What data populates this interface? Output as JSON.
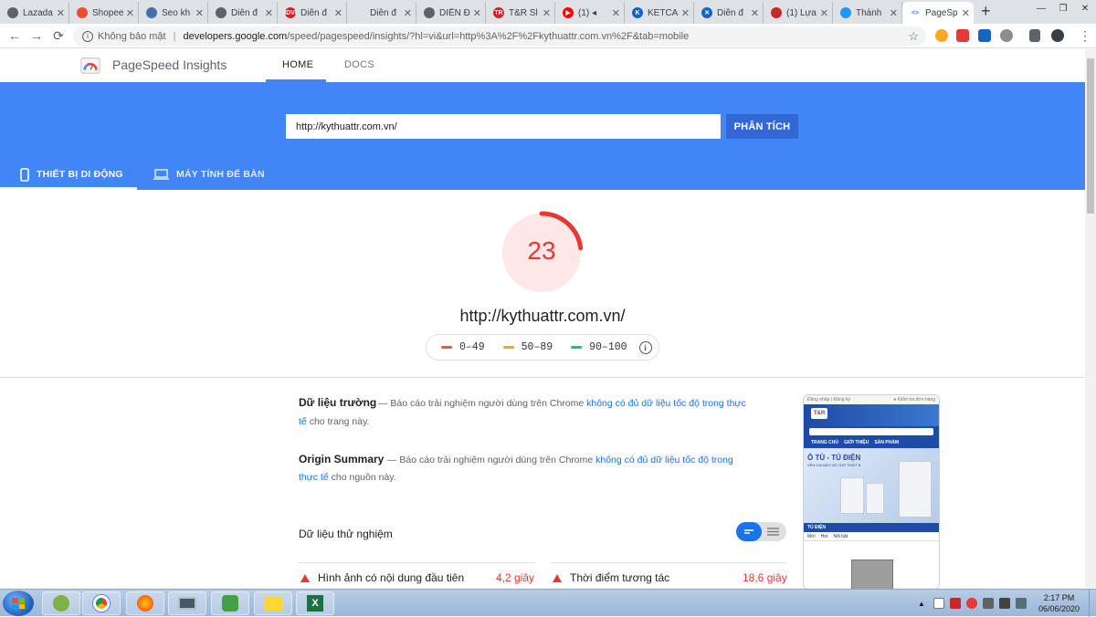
{
  "browser": {
    "tabs": [
      {
        "title": "Lazada",
        "favicon_color": "#5f6368",
        "favicon_glyph": ""
      },
      {
        "title": "Shopee",
        "favicon_color": "#ee4d2d",
        "favicon_glyph": ""
      },
      {
        "title": "Seo kh",
        "favicon_color": "#4a6ea9",
        "favicon_glyph": ""
      },
      {
        "title": "Diễn đ",
        "favicon_color": "#5f6368",
        "favicon_glyph": ""
      },
      {
        "title": "Diễn đ",
        "favicon_color": "#c62828",
        "favicon_glyph": "IDVI"
      },
      {
        "title": "Diễn đ",
        "favicon_color": "#dee1e6",
        "favicon_glyph": ""
      },
      {
        "title": "DIỄN Đ",
        "favicon_color": "#5f6368",
        "favicon_glyph": ""
      },
      {
        "title": "T&R Sl",
        "favicon_color": "#c62828",
        "favicon_glyph": "TR"
      },
      {
        "title": "(1) ◂",
        "favicon_color": "#ff0000",
        "favicon_glyph": "▶"
      },
      {
        "title": "KETCA",
        "favicon_color": "#1565c0",
        "favicon_glyph": "K"
      },
      {
        "title": "Diễn đ",
        "favicon_color": "#1565c0",
        "favicon_glyph": "✕"
      },
      {
        "title": "(1) Lựa",
        "favicon_color": "#c62828",
        "favicon_glyph": ""
      },
      {
        "title": "Thành",
        "favicon_color": "#2196f3",
        "favicon_glyph": ""
      },
      {
        "title": "PageSp",
        "favicon_color": "#4285f4",
        "favicon_glyph": "<>",
        "active": true
      }
    ],
    "new_tab_label": "+",
    "insecure_label": "Không bảo mật",
    "url_host": "developers.google.com",
    "url_path": "/speed/pagespeed/insights/?hl=vi&url=http%3A%2F%2Fkythuattr.com.vn%2F&tab=mobile"
  },
  "header": {
    "brand": "PageSpeed Insights",
    "nav_home": "HOME",
    "nav_docs": "DOCS"
  },
  "hero": {
    "input_value": "http://kythuattr.com.vn/",
    "analyze_label": "PHÂN TÍCH",
    "tab_mobile": "THIẾT BỊ DI ĐỘNG",
    "tab_desktop": "MÁY TÍNH ĐỂ BÀN"
  },
  "score": {
    "value": "23",
    "fraction": 0.23,
    "color": "#e53935",
    "url": "http://kythuattr.com.vn/"
  },
  "legend": {
    "poor": {
      "label": "0–49",
      "color": "#ff4e42"
    },
    "average": {
      "label": "50–89",
      "color": "#ffa400"
    },
    "good": {
      "label": "90–100",
      "color": "#0cce6b"
    }
  },
  "field_data": {
    "title": "Dữ liệu trường",
    "dash": "—",
    "desc_prefix": "Báo cáo trải nghiệm người dùng trên Chrome",
    "link_text_1": "không có đủ dữ liệu tốc độ trong thực",
    "link_text_2": "tế",
    "desc_suffix": "cho trang này."
  },
  "origin_summary": {
    "title": "Origin Summary",
    "dash": "—",
    "desc_prefix": "Báo cáo trải nghiệm người dùng trên Chrome",
    "link_text_1": "không có đủ dữ liệu tốc độ trong",
    "link_text_2": "thực tế",
    "desc_suffix": "cho nguồn này."
  },
  "lab_data": {
    "title": "Dữ liệu thử nghiệm",
    "metrics": [
      {
        "label": "Hình ảnh có nội dung đầu tiên",
        "value": "4,2 giây"
      },
      {
        "label": "Thời điểm tương tác",
        "value": "18,6 giây"
      }
    ]
  },
  "thumbnail": {
    "top_left": "Đăng nhập | Đăng ký",
    "top_right": "● Kiểm tra đơn hàng",
    "logo": "T&R",
    "menu": [
      "TRANG CHỦ",
      "GIỚI THIỆU",
      "SẢN PHẨM"
    ],
    "hero_title": "Ô TỦ - TỦ ĐIỆN",
    "hero_sub": "VÊN GIA BẢO VỆ CHO THIẾT B",
    "category": "TỦ ĐIỆN",
    "subtabs": [
      "Mới",
      "Hot",
      "Nổi bật"
    ]
  },
  "taskbar": {
    "time": "2:17 PM",
    "date": "06/06/2020"
  }
}
